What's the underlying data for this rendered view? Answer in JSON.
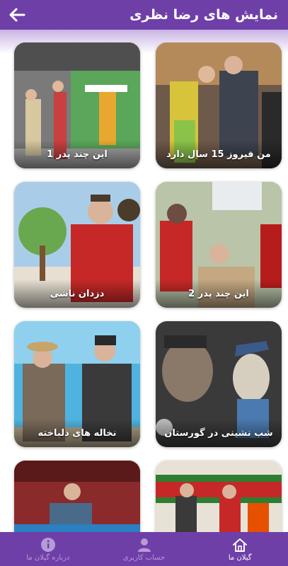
{
  "header": {
    "title": "نمایش های رضا نظری"
  },
  "cards": [
    {
      "title": "من فیروز 15 سال دارد"
    },
    {
      "title": "این چند پدر 1"
    },
    {
      "title": "این چند پدر 2"
    },
    {
      "title": "دزدان ناشی"
    },
    {
      "title": "شب نشینی در گورستان"
    },
    {
      "title": "نخاله های دلباخته"
    },
    {
      "title": ""
    },
    {
      "title": ""
    }
  ],
  "bottom_nav": {
    "items": [
      {
        "label": "گیلان ما",
        "icon": "home-icon",
        "active": true
      },
      {
        "label": "حساب کاربری",
        "icon": "user-icon",
        "active": false
      },
      {
        "label": "درباره گیلان ما",
        "icon": "info-icon",
        "active": false
      }
    ]
  },
  "colors": {
    "primary": "#6f3fa8",
    "nav_inactive": "#b79ad8"
  }
}
